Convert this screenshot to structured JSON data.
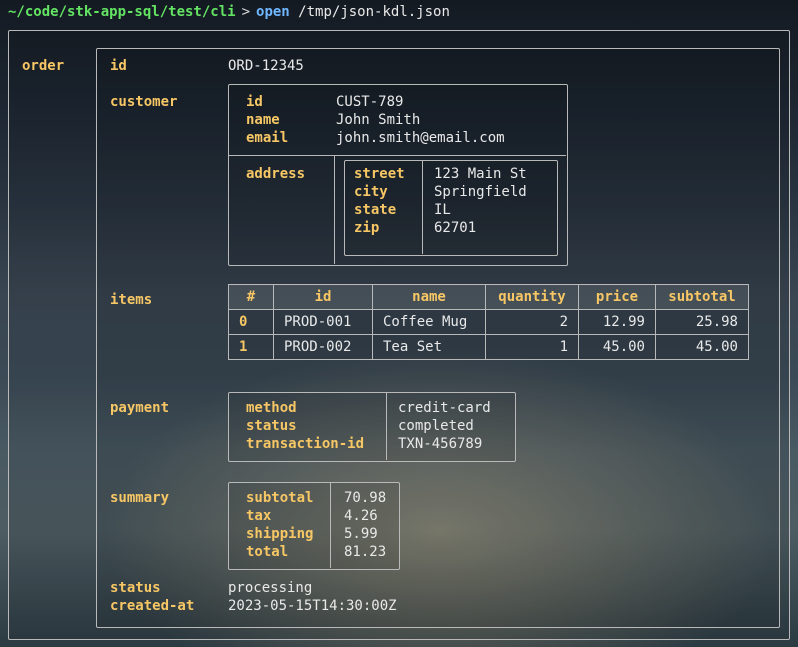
{
  "prompt": {
    "path": "~/code/stk-app-sql/test/cli",
    "gt": ">",
    "cmd": "open",
    "arg": "/tmp/json-kdl.json"
  },
  "root": {
    "label": "order"
  },
  "order": {
    "id_label": "id",
    "id": "ORD-12345",
    "customer_label": "customer",
    "customer": {
      "id_label": "id",
      "id": "CUST-789",
      "name_label": "name",
      "name": "John Smith",
      "email_label": "email",
      "email": "john.smith@email.com",
      "address_label": "address",
      "address": {
        "street_label": "street",
        "street": "123 Main St",
        "city_label": "city",
        "city": "Springfield",
        "state_label": "state",
        "state": "IL",
        "zip_label": "zip",
        "zip": "62701"
      }
    },
    "items_label": "items",
    "items": {
      "headers": {
        "index": "#",
        "id": "id",
        "name": "name",
        "quantity": "quantity",
        "price": "price",
        "subtotal": "subtotal"
      },
      "rows": [
        {
          "index": "0",
          "id": "PROD-001",
          "name": "Coffee Mug",
          "quantity": "2",
          "price": "12.99",
          "subtotal": "25.98"
        },
        {
          "index": "1",
          "id": "PROD-002",
          "name": "Tea Set",
          "quantity": "1",
          "price": "45.00",
          "subtotal": "45.00"
        }
      ]
    },
    "payment_label": "payment",
    "payment": {
      "method_label": "method",
      "method": "credit-card",
      "status_label": "status",
      "status": "completed",
      "txn_label": "transaction-id",
      "txn": "TXN-456789"
    },
    "summary_label": "summary",
    "summary": {
      "subtotal_label": "subtotal",
      "subtotal": "70.98",
      "tax_label": "tax",
      "tax": "4.26",
      "shipping_label": "shipping",
      "shipping": "5.99",
      "total_label": "total",
      "total": "81.23"
    },
    "status_label": "status",
    "status": "processing",
    "created_label": "created-at",
    "created": "2023-05-15T14:30:00Z"
  },
  "chart_data": {
    "type": "table",
    "title": "items",
    "columns": [
      "#",
      "id",
      "name",
      "quantity",
      "price",
      "subtotal"
    ],
    "rows": [
      [
        "0",
        "PROD-001",
        "Coffee Mug",
        2,
        12.99,
        25.98
      ],
      [
        "1",
        "PROD-002",
        "Tea Set",
        1,
        45.0,
        45.0
      ]
    ]
  }
}
